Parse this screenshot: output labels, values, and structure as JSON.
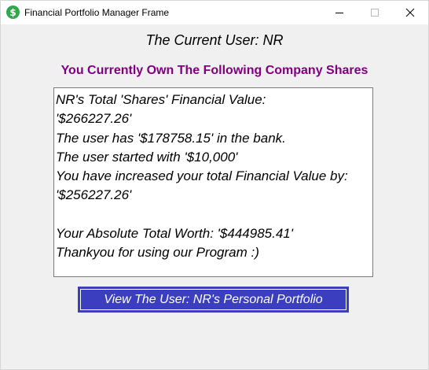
{
  "window": {
    "title": "Financial Portfolio Manager Frame",
    "app_icon_glyph": "$",
    "app_icon_name": "dollar-icon"
  },
  "colors": {
    "background": "#f0f0f0",
    "titlebar": "#ffffff",
    "heading_purple": "#800080",
    "button_blue": "#3b3fbf",
    "app_icon_green": "#2ea84a"
  },
  "main": {
    "current_user": "The Current User: NR",
    "shares_heading": "You Currently Own The Following Company Shares",
    "info_lines": [
      "NR's Total 'Shares' Financial Value:",
      "'$266227.26'",
      "The user has '$178758.15' in the bank.",
      "The user started with '$10,000'",
      "You have increased your total Financial Value by:",
      "'$256227.26'",
      "",
      "Your Absolute Total Worth: '$444985.41'",
      "Thankyou for using our Program :)"
    ],
    "portfolio_button_label": "View The User: NR's Personal Portfolio"
  }
}
